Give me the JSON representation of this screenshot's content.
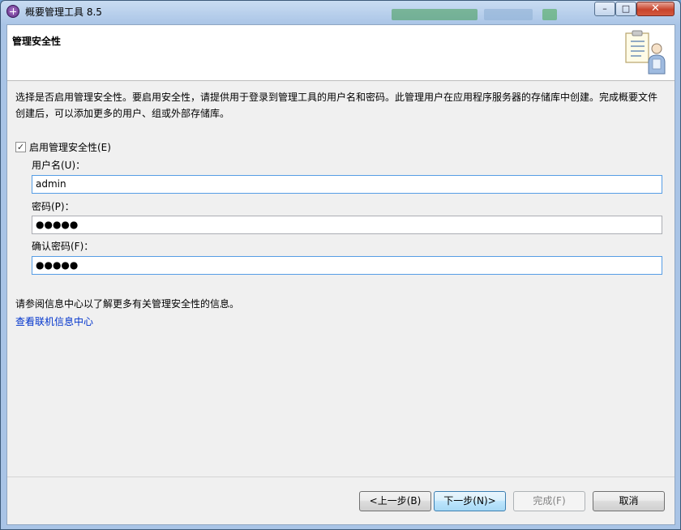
{
  "window": {
    "title": "概要管理工具 8.5",
    "minimize": "–",
    "maximize": "□",
    "close": "✕"
  },
  "banner": {
    "title": "管理安全性"
  },
  "description": "选择是否启用管理安全性。要启用安全性，请提供用于登录到管理工具的用户名和密码。此管理用户在应用程序服务器的存储库中创建。完成概要文件创建后，可以添加更多的用户、组或外部存储库。",
  "security": {
    "enable_label": "启用管理安全性(E)",
    "enabled": true,
    "check_mark": "✓"
  },
  "fields": {
    "username_label": "用户名(U)：",
    "username_value": "admin",
    "password_label": "密码(P)：",
    "password_value": "●●●●●",
    "confirm_label": "确认密码(F)：",
    "confirm_value": "●●●●●"
  },
  "help": {
    "text": "请参阅信息中心以了解更多有关管理安全性的信息。",
    "link": "查看联机信息中心"
  },
  "buttons": {
    "back": "<上一步(B)",
    "next": "下一步(N)>",
    "finish": "完成(F)",
    "cancel": "取消"
  },
  "colors": {
    "link": "#0033cc",
    "focus_border": "#569de5"
  }
}
